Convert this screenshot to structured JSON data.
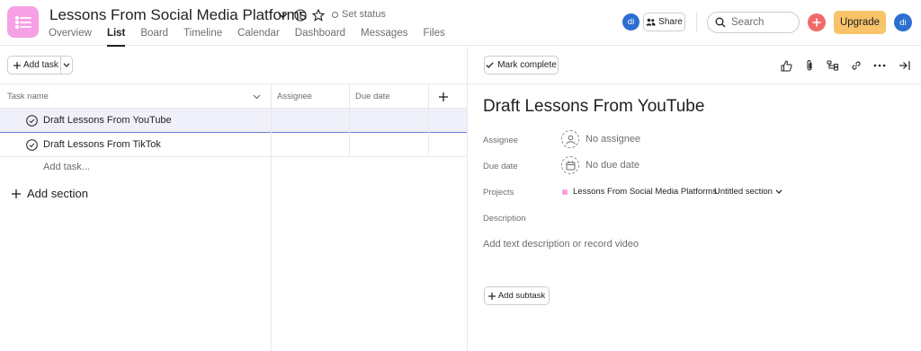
{
  "header": {
    "project_title": "Lessons From Social Media Platforms",
    "set_status": "Set status",
    "tabs": [
      {
        "label": "Overview"
      },
      {
        "label": "List"
      },
      {
        "label": "Board"
      },
      {
        "label": "Timeline"
      },
      {
        "label": "Calendar"
      },
      {
        "label": "Dashboard"
      },
      {
        "label": "Messages"
      },
      {
        "label": "Files"
      }
    ],
    "active_tab": "List",
    "member_avatar": "di",
    "share_label": "Share",
    "search_placeholder": "Search",
    "upgrade_label": "Upgrade",
    "user_avatar": "di"
  },
  "list": {
    "add_task_label": "Add task",
    "columns": {
      "name": "Task name",
      "assignee": "Assignee",
      "due_date": "Due date"
    },
    "tasks": [
      {
        "name": "Draft Lessons From YouTube"
      },
      {
        "name": "Draft Lessons From TikTok"
      }
    ],
    "add_task_inline": "Add task...",
    "add_section": "Add section"
  },
  "detail": {
    "mark_complete": "Mark complete",
    "title": "Draft Lessons From YouTube",
    "assignee_label": "Assignee",
    "assignee_value": "No assignee",
    "due_label": "Due date",
    "due_value": "No due date",
    "projects_label": "Projects",
    "project_name": "Lessons From Social Media Platforms",
    "section_name": "Untitled section",
    "description_label": "Description",
    "description_placeholder": "Add text description or record video",
    "add_subtask": "Add subtask"
  },
  "colors": {
    "project_icon": "#f5a1e4",
    "avatar": "#2d6fd1",
    "plus_button": "#f06a6a",
    "upgrade_button": "#f8c369",
    "selected_row": "#f0f0fb"
  }
}
